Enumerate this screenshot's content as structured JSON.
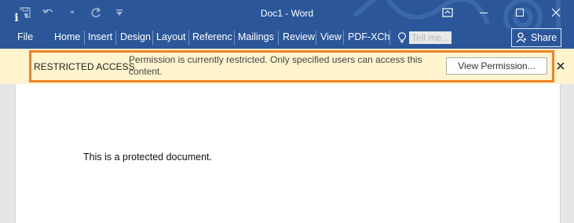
{
  "title_bar": {
    "document_title": "Doc1 - Word",
    "quick_access": [
      "save-icon",
      "undo-icon",
      "redo-icon",
      "customize-caret-icon"
    ],
    "window_controls": [
      "ribbon-display-options-icon",
      "minimize-icon",
      "maximize-icon",
      "close-icon"
    ]
  },
  "ribbon": {
    "file_label": "File",
    "tabs": [
      "Home",
      "Insert",
      "Design",
      "Layout",
      "Referenc",
      "Mailings",
      "Review",
      "View",
      "PDF-XCh"
    ],
    "tell_me": "Tell me...",
    "share_label": "Share"
  },
  "infobar": {
    "label": "RESTRICTED ACCESS",
    "message": "Permission is currently restricted. Only specified users can access this content.",
    "button_label": "View Permission...",
    "icon": "info-icon",
    "close_icon": "close-icon"
  },
  "document": {
    "body_text": "This is a protected document."
  },
  "colors": {
    "ribbon": "#2b579a",
    "infobar": "#fff4ce",
    "highlight": "#f0822a"
  }
}
